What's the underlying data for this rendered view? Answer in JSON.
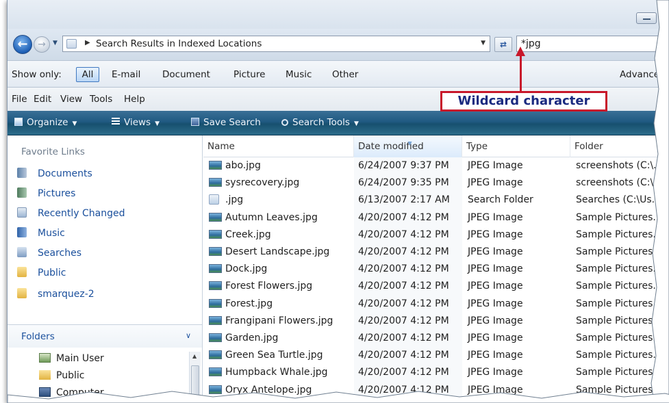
{
  "address": {
    "path": "Search Results in Indexed Locations",
    "search_value": "*jpg"
  },
  "show_only": {
    "label": "Show only:",
    "items": [
      "All",
      "E-mail",
      "Document",
      "Picture",
      "Music",
      "Other"
    ],
    "selected": "All",
    "advanced": "Advanced"
  },
  "menu": [
    "File",
    "Edit",
    "View",
    "Tools",
    "Help"
  ],
  "commands": {
    "organize": "Organize",
    "views": "Views",
    "save_search": "Save Search",
    "search_tools": "Search Tools"
  },
  "callout": "Wildcard character",
  "sidebar": {
    "favorites_header": "Favorite Links",
    "favorites": [
      {
        "label": "Documents",
        "icon": "documents-icon"
      },
      {
        "label": "Pictures",
        "icon": "pictures-icon"
      },
      {
        "label": "Recently Changed",
        "icon": "recently-changed-icon"
      },
      {
        "label": "Music",
        "icon": "music-icon"
      },
      {
        "label": "Searches",
        "icon": "searches-icon"
      },
      {
        "label": "Public",
        "icon": "folder-icon"
      },
      {
        "label": "smarquez-2",
        "icon": "folder-icon"
      }
    ],
    "folders_header": "Folders",
    "tree": [
      {
        "label": "Main User",
        "icon": "user-folder-icon"
      },
      {
        "label": "Public",
        "icon": "folder-icon"
      },
      {
        "label": "Computer",
        "icon": "computer-icon"
      }
    ]
  },
  "columns": [
    "Name",
    "Date modified",
    "Type",
    "Folder"
  ],
  "sorted_column": "Date modified",
  "files": [
    {
      "name": "abo.jpg",
      "date": "6/24/2007 9:37 PM",
      "type": "JPEG Image",
      "folder": "screenshots (C:\\...",
      "icon": "image-file-icon"
    },
    {
      "name": "sysrecovery.jpg",
      "date": "6/24/2007 9:35 PM",
      "type": "JPEG Image",
      "folder": "screenshots (C:\\...",
      "icon": "image-file-icon"
    },
    {
      "name": ".jpg",
      "date": "6/13/2007 2:17 AM",
      "type": "Search Folder",
      "folder": "Searches (C:\\Us...",
      "icon": "search-folder-icon"
    },
    {
      "name": "Autumn Leaves.jpg",
      "date": "4/20/2007 4:12 PM",
      "type": "JPEG Image",
      "folder": "Sample Pictures...",
      "icon": "image-file-icon"
    },
    {
      "name": "Creek.jpg",
      "date": "4/20/2007 4:12 PM",
      "type": "JPEG Image",
      "folder": "Sample Pictures...",
      "icon": "image-file-icon"
    },
    {
      "name": "Desert Landscape.jpg",
      "date": "4/20/2007 4:12 PM",
      "type": "JPEG Image",
      "folder": "Sample Pictures...",
      "icon": "image-file-icon"
    },
    {
      "name": "Dock.jpg",
      "date": "4/20/2007 4:12 PM",
      "type": "JPEG Image",
      "folder": "Sample Pictures...",
      "icon": "image-file-icon"
    },
    {
      "name": "Forest Flowers.jpg",
      "date": "4/20/2007 4:12 PM",
      "type": "JPEG Image",
      "folder": "Sample Pictures...",
      "icon": "image-file-icon"
    },
    {
      "name": "Forest.jpg",
      "date": "4/20/2007 4:12 PM",
      "type": "JPEG Image",
      "folder": "Sample Pictures...",
      "icon": "image-file-icon"
    },
    {
      "name": "Frangipani Flowers.jpg",
      "date": "4/20/2007 4:12 PM",
      "type": "JPEG Image",
      "folder": "Sample Pictures...",
      "icon": "image-file-icon"
    },
    {
      "name": "Garden.jpg",
      "date": "4/20/2007 4:12 PM",
      "type": "JPEG Image",
      "folder": "Sample Pictures...",
      "icon": "image-file-icon"
    },
    {
      "name": "Green Sea Turtle.jpg",
      "date": "4/20/2007 4:12 PM",
      "type": "JPEG Image",
      "folder": "Sample Pictures...",
      "icon": "image-file-icon"
    },
    {
      "name": "Humpback Whale.jpg",
      "date": "4/20/2007 4:12 PM",
      "type": "JPEG Image",
      "folder": "Sample Pictures...",
      "icon": "image-file-icon"
    },
    {
      "name": "Oryx Antelope.jpg",
      "date": "4/20/2007 4:12 PM",
      "type": "JPEG Image",
      "folder": "Sample Pictures...",
      "icon": "image-file-icon"
    }
  ],
  "colors": {
    "command_bar": "#205a82",
    "link_blue": "#1a4f9c",
    "callout_border": "#c8172a",
    "callout_text": "#1a2a80"
  }
}
